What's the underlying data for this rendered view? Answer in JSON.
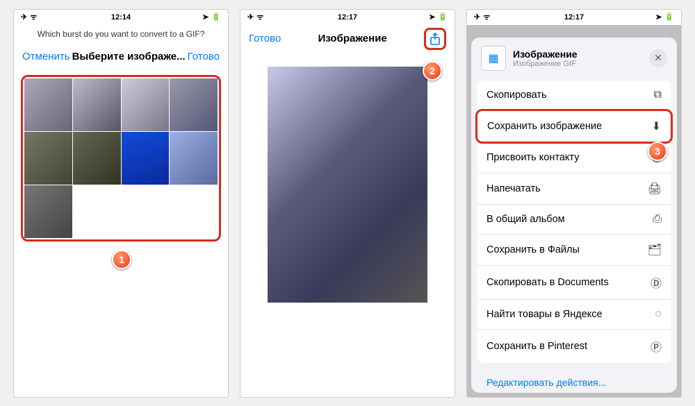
{
  "screen1": {
    "time": "12:14",
    "subheader": "Which burst do you want to convert to a GIF?",
    "nav_cancel": "Отменить",
    "nav_title": "Выберите изображе...",
    "nav_done": "Готово",
    "thumbs": [
      "linear-gradient(135deg,#aab,#667)",
      "linear-gradient(135deg,#bbc,#556)",
      "linear-gradient(135deg,#ccd,#778)",
      "linear-gradient(135deg,#99a,#557)",
      "linear-gradient(135deg,#776,#443)",
      "linear-gradient(135deg,#665,#332)",
      "linear-gradient(160deg,#114bdc,#0a2a9a)",
      "linear-gradient(135deg,#9ab0e0,#5a6aa0)",
      "linear-gradient(135deg,#777,#444)",
      "#fff",
      "#fff",
      "#fff"
    ],
    "badge": "1"
  },
  "screen2": {
    "time": "12:17",
    "nav_done": "Готово",
    "nav_title": "Изображение",
    "badge": "2"
  },
  "screen3": {
    "time": "12:17",
    "file_title": "Изображение",
    "file_sub": "Изображение GIF",
    "actions": [
      {
        "label": "Скопировать",
        "icon": "⧉"
      },
      {
        "label": "Сохранить изображение",
        "icon": "⬇"
      },
      {
        "label": "Присвоить контакту",
        "icon": "◉"
      },
      {
        "label": "Напечатать",
        "icon": "🖨"
      },
      {
        "label": "В общий альбом",
        "icon": "⎙"
      },
      {
        "label": "Сохранить в Файлы",
        "icon": "🗂"
      },
      {
        "label": "Скопировать в Documents",
        "icon": "Ⓓ"
      },
      {
        "label": "Найти товары в Яндексе",
        "icon": "◌"
      },
      {
        "label": "Сохранить в Pinterest",
        "icon": "Ⓟ"
      }
    ],
    "highlight_index": 1,
    "edit_label": "Редактировать действия...",
    "badge": "3"
  },
  "status_icons": {
    "plane": "✈︎",
    "wifi": "ᯤ",
    "loc": "➤",
    "batt": "🔋"
  }
}
